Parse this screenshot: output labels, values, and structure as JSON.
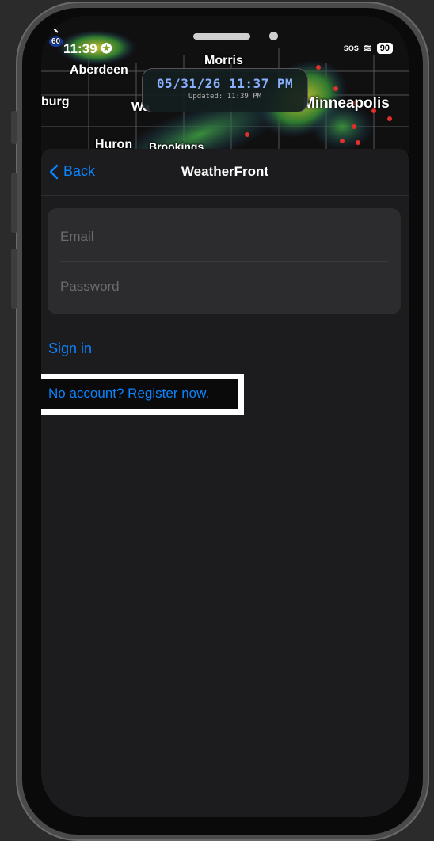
{
  "status_bar": {
    "time": "11:39",
    "sos": "SOS",
    "battery": "90"
  },
  "map": {
    "cities": [
      "Aberdeen",
      "Morris",
      "burg",
      "Wa",
      "Minneapolis",
      "Huron",
      "Brookings"
    ],
    "timestamp": "05/31/26 11:37 PM",
    "updated": "Updated: 11:39 PM",
    "badge": "60"
  },
  "navbar": {
    "back_label": "Back",
    "title": "WeatherFront"
  },
  "form": {
    "email_placeholder": "Email",
    "password_placeholder": "Password"
  },
  "actions": {
    "sign_in": "Sign in",
    "register": "No account? Register now."
  },
  "colors": {
    "accent": "#0a84ff",
    "sheet_bg": "#1c1c1e",
    "field_bg": "#2c2c2e"
  }
}
